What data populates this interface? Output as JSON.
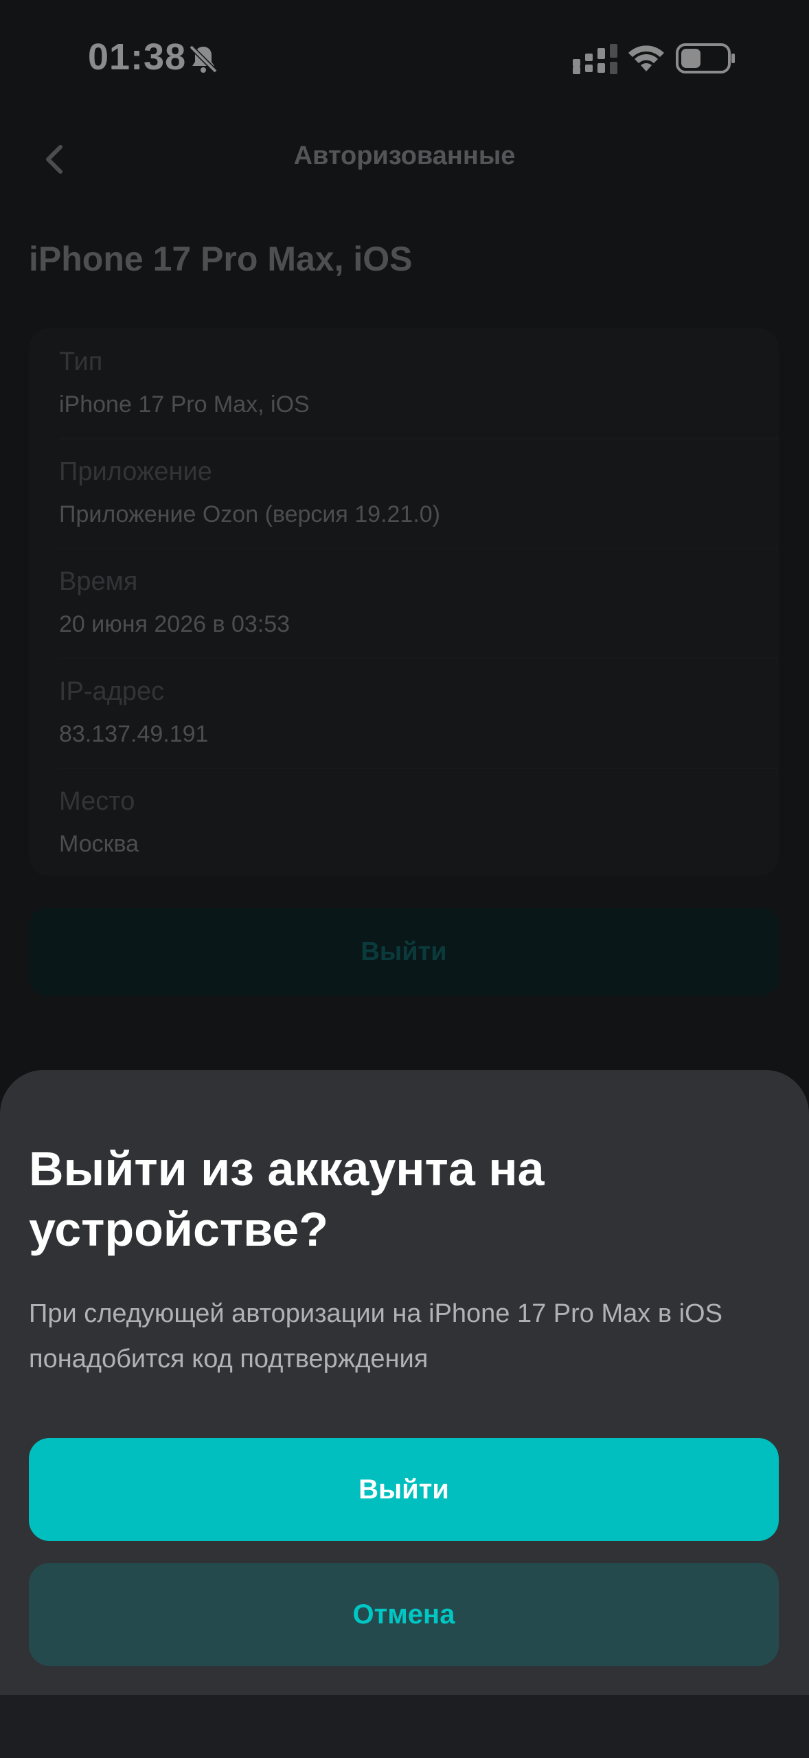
{
  "status_bar": {
    "time": "01:38",
    "icons": [
      "bell-off-icon",
      "signal-icon",
      "wifi-icon",
      "battery-icon"
    ],
    "battery_level": 0.4
  },
  "header": {
    "title": "Авторизованные",
    "back_icon": "chevron-left-icon"
  },
  "device": {
    "title": "iPhone 17 Pro Max, iOS",
    "rows": [
      {
        "label": "Тип",
        "value": "iPhone 17 Pro Max, iOS"
      },
      {
        "label": "Приложение",
        "value": "Приложение Ozon (версия 19.21.0)"
      },
      {
        "label": "Время",
        "value": "20 июня 2026 в 03:53"
      },
      {
        "label": "IP-адрес",
        "value": "83.137.49.191"
      },
      {
        "label": "Место",
        "value": "Москва"
      }
    ],
    "logout_label": "Выйти"
  },
  "sheet": {
    "title": "Выйти из аккаунта на устройстве?",
    "text": "При следующей авторизации на iPhone 17 Pro Max в iOS понадобится код подтверждения",
    "confirm_label": "Выйти",
    "cancel_label": "Отмена"
  },
  "colors": {
    "accent": "#00bfbe",
    "sheet_background": "#303236",
    "cancel_background": "#254a4d"
  }
}
